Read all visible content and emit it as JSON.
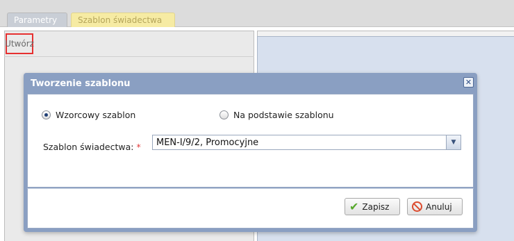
{
  "tabs": [
    {
      "label": "Parametry"
    },
    {
      "label": "Szablon świadectwa"
    }
  ],
  "toolbar": {
    "create_label": "Utwórz"
  },
  "dialog": {
    "title": "Tworzenie szablonu",
    "close_icon": "close-icon",
    "radio_template": "Wzorcowy szablon",
    "radio_based_on": "Na podstawie szablonu",
    "selected_option": "Wzorcowy szablon",
    "field_label": "Szablon świadectwa:",
    "required_marker": "*",
    "select_value": "MEN-I/9/2, Promocyjne",
    "save_label": "Zapisz",
    "cancel_label": "Anuluj"
  },
  "colors": {
    "header_blue": "#8a9fc2",
    "active_tab": "#f6eba3",
    "highlight_red": "#e63030"
  }
}
